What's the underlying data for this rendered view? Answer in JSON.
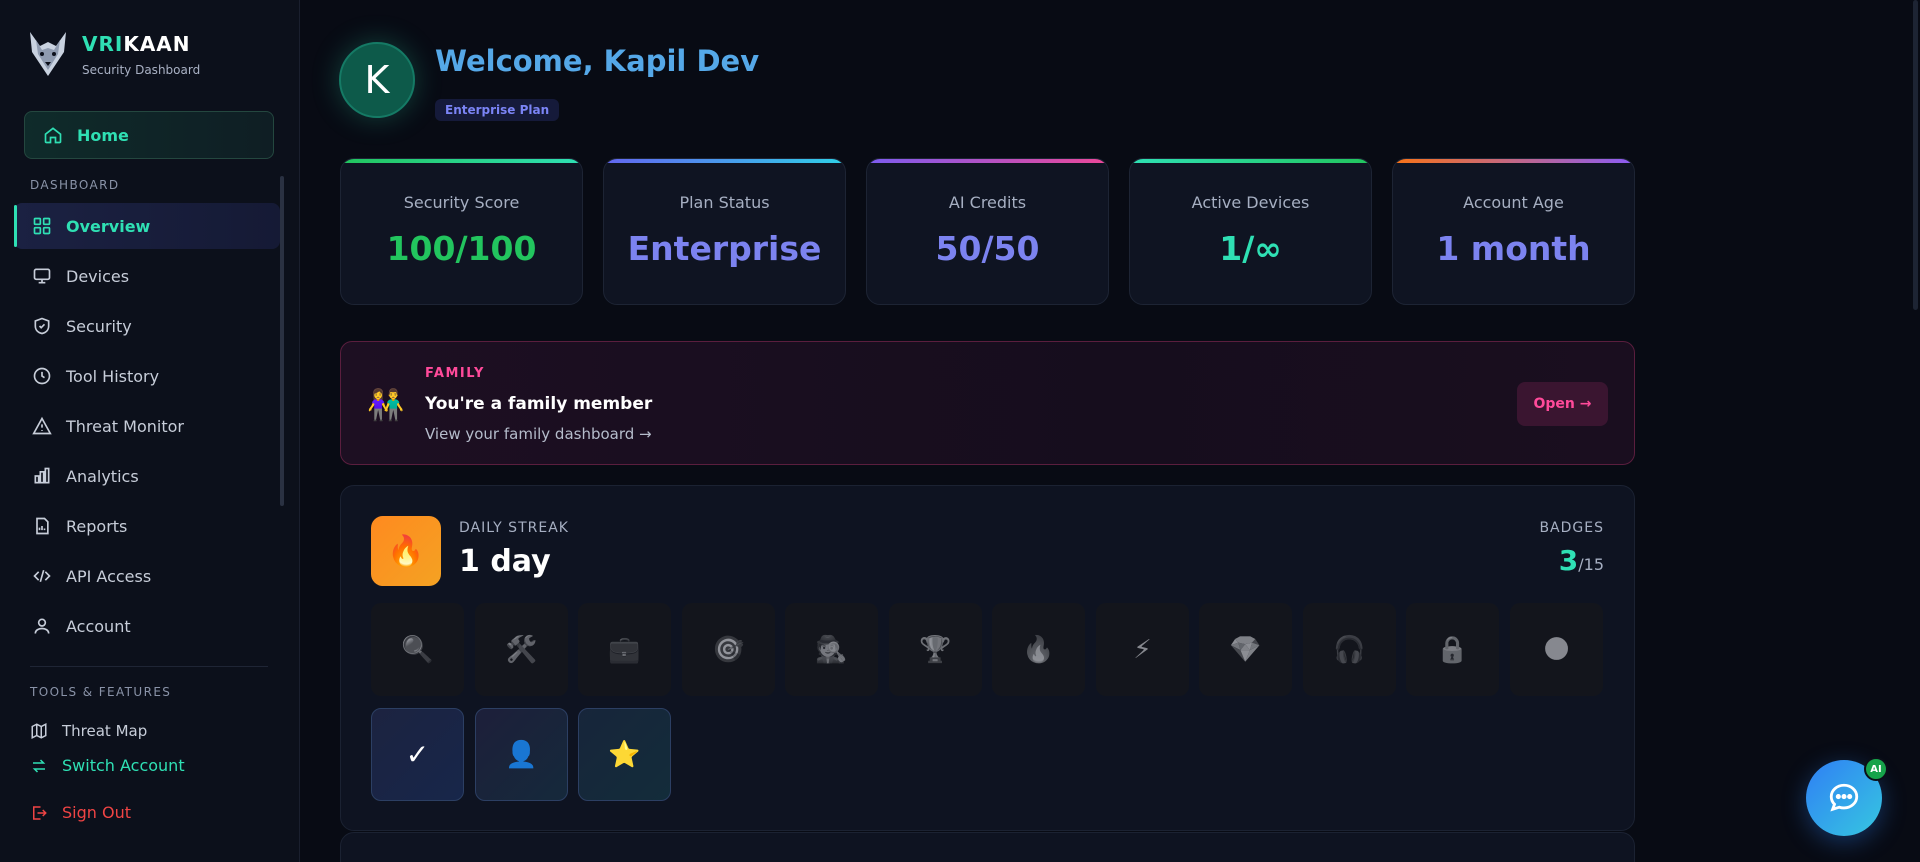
{
  "brand": {
    "name_part1": "VRI",
    "name_part2": "KAAN",
    "subtitle": "Security Dashboard"
  },
  "sidebar": {
    "home_label": "Home",
    "dashboard_section": "DASHBOARD",
    "items": [
      {
        "label": "Overview",
        "icon": "grid-icon",
        "active": true
      },
      {
        "label": "Devices",
        "icon": "monitor-icon"
      },
      {
        "label": "Security",
        "icon": "shield-icon"
      },
      {
        "label": "Tool History",
        "icon": "clock-icon"
      },
      {
        "label": "Threat Monitor",
        "icon": "alert-triangle-icon"
      },
      {
        "label": "Analytics",
        "icon": "bar-chart-icon"
      },
      {
        "label": "Reports",
        "icon": "report-icon"
      },
      {
        "label": "API Access",
        "icon": "code-icon"
      },
      {
        "label": "Account",
        "icon": "user-icon"
      }
    ],
    "tools_section": "TOOLS & FEATURES",
    "threat_map": "Threat Map",
    "switch_account": "Switch Account",
    "sign_out": "Sign Out"
  },
  "header": {
    "avatar_initial": "K",
    "welcome": "Welcome, Kapil Dev",
    "plan_badge": "Enterprise Plan"
  },
  "stats": [
    {
      "label": "Security Score",
      "value": "100/100",
      "color": "#22c55e"
    },
    {
      "label": "Plan Status",
      "value": "Enterprise",
      "color": "#7c83f0"
    },
    {
      "label": "AI Credits",
      "value": "50/50",
      "color": "#7c83f0"
    },
    {
      "label": "Active Devices",
      "value": "1/∞",
      "color": "#2fe0b4"
    },
    {
      "label": "Account Age",
      "value": "1 month",
      "color": "#7c83f0"
    }
  ],
  "family": {
    "tag": "FAMILY",
    "title": "You're a family member",
    "subtitle": "View your family dashboard →",
    "button": "Open →",
    "icon": "👫"
  },
  "streak": {
    "label": "DAILY STREAK",
    "value": "1 day",
    "badges_label": "BADGES",
    "badges_count": "3",
    "badges_total": "/15",
    "locked_badges": [
      "🔍",
      "🛠️",
      "💼",
      "🎯",
      "🕵️",
      "🏆",
      "🔥",
      "⚡",
      "💎",
      "🎧",
      "🔒",
      "🌑"
    ],
    "earned_badges": [
      "✓",
      "👤",
      "⭐"
    ]
  },
  "chat": {
    "ai_badge": "AI"
  }
}
